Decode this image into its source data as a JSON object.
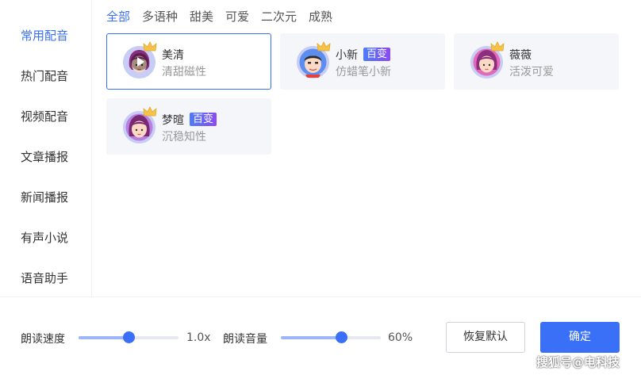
{
  "sidebar": {
    "items": [
      {
        "label": "常用配音",
        "active": true
      },
      {
        "label": "热门配音",
        "active": false
      },
      {
        "label": "视频配音",
        "active": false
      },
      {
        "label": "文章播报",
        "active": false
      },
      {
        "label": "新闻播报",
        "active": false
      },
      {
        "label": "有声小说",
        "active": false
      },
      {
        "label": "语音助手",
        "active": false
      }
    ]
  },
  "tabs": [
    {
      "label": "全部",
      "active": true
    },
    {
      "label": "多语种"
    },
    {
      "label": "甜美"
    },
    {
      "label": "可爱"
    },
    {
      "label": "二次元"
    },
    {
      "label": "成熟"
    }
  ],
  "voices": [
    {
      "name": "美清",
      "desc": "清甜磁性",
      "badge": "",
      "selected": true,
      "avatar_icon": "girl-avatar-icon",
      "playing_icon": "play-icon"
    },
    {
      "name": "小新",
      "desc": "仿蜡笔小新",
      "badge": "百变",
      "selected": false,
      "avatar_icon": "boy-avatar-icon"
    },
    {
      "name": "薇薇",
      "desc": "活泼可爱",
      "badge": "",
      "selected": false,
      "avatar_icon": "girl-avatar-icon"
    },
    {
      "name": "梦暄",
      "desc": "沉稳知性",
      "badge": "百变",
      "selected": false,
      "avatar_icon": "girl-avatar-icon"
    }
  ],
  "controls": {
    "speed": {
      "label": "朗读速度",
      "value_text": "1.0x",
      "level": 0.5
    },
    "volume": {
      "label": "朗读音量",
      "value_text": "60%",
      "level": 0.6
    },
    "reset_label": "恢复默认",
    "confirm_label": "确定"
  },
  "watermark": "搜狐号@电科技",
  "colors": {
    "accent": "#3a6ff7",
    "badge_from": "#4b7df8",
    "badge_to": "#8c4bf0"
  }
}
